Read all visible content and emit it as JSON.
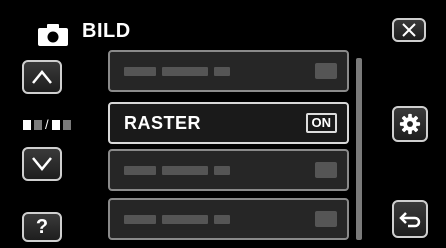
{
  "header": {
    "title": "BILD",
    "icon": "camera-icon"
  },
  "nav": {
    "close_icon": "close-icon",
    "up_icon": "chevron-up-icon",
    "down_icon": "chevron-down-icon",
    "help_label": "?",
    "settings_icon": "gear-icon",
    "back_icon": "back-arrow-icon"
  },
  "menu": {
    "items": [
      {
        "label": "",
        "value": ""
      },
      {
        "label": "RASTER",
        "value": "ON"
      },
      {
        "label": "",
        "value": ""
      },
      {
        "label": "",
        "value": ""
      }
    ]
  }
}
